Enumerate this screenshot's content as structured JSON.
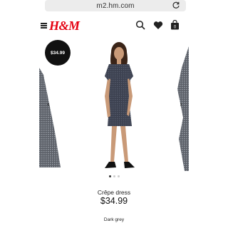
{
  "browser": {
    "url": "m2.hm.com"
  },
  "header": {
    "logo": "H&M"
  },
  "product": {
    "badge_price": "$34.99",
    "name": "Crêpe dress",
    "price": "$34.99",
    "color": "Dark grey",
    "image_count": 3,
    "active_image": 1
  },
  "carousel": {
    "prev_arrow": "‹",
    "next_arrow": "›"
  },
  "icons": [
    "menu-icon",
    "search-icon",
    "heart-icon",
    "bag-icon",
    "reload-icon",
    "chevron-left-icon",
    "chevron-right-icon"
  ],
  "colors": {
    "brand": "#e50010",
    "dress": "#3c4150"
  }
}
